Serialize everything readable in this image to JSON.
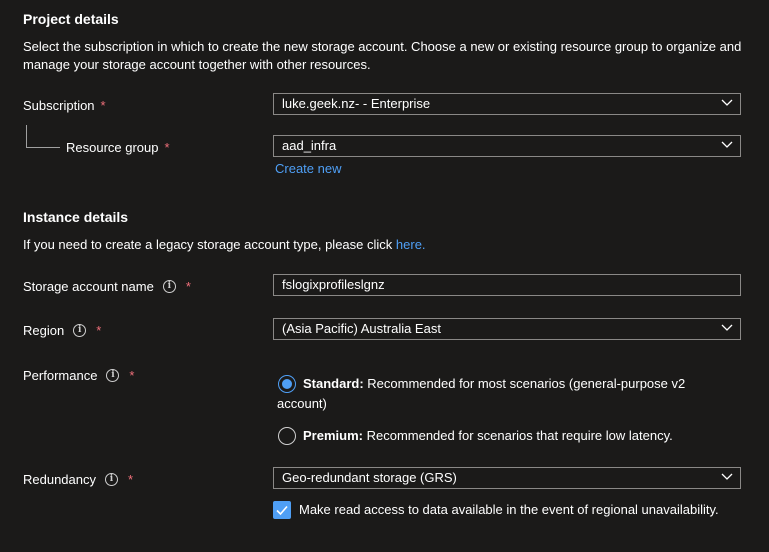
{
  "project": {
    "heading": "Project details",
    "description": "Select the subscription in which to create the new storage account. Choose a new or existing resource group to organize and manage your storage account together with other resources.",
    "subscription_label": "Subscription",
    "subscription_value": "luke.geek.nz- - Enterprise",
    "resource_group_label": "Resource group",
    "resource_group_value": "aad_infra",
    "create_new": "Create new"
  },
  "instance": {
    "heading": "Instance details",
    "description": "If you need to create a legacy storage account type, please click",
    "here_link": "here.",
    "storage_name_label": "Storage account name",
    "storage_name_value": "fslogixprofileslgnz",
    "region_label": "Region",
    "region_value": "(Asia Pacific) Australia East",
    "performance_label": "Performance",
    "standard_title": "Standard:",
    "standard_desc": "Recommended for most scenarios (general-purpose v2",
    "standard_desc2": "account)",
    "premium_title": "Premium:",
    "premium_desc": "Recommended for scenarios that require low latency.",
    "redundancy_label": "Redundancy",
    "redundancy_value": "Geo-redundant storage (GRS)",
    "read_access_label": "Make read access to data available in the event of regional unavailability."
  },
  "common": {
    "required_mark": "*",
    "info_glyph": "i"
  },
  "state": {
    "performance_selected": "Standard",
    "read_access_checked": true
  },
  "colors": {
    "background": "#1b1a19",
    "accent": "#4f9ff5",
    "required": "#f1707b",
    "border": "#8a8886"
  },
  "icons": [
    "chevron-down-icon",
    "info-icon",
    "check-icon"
  ]
}
